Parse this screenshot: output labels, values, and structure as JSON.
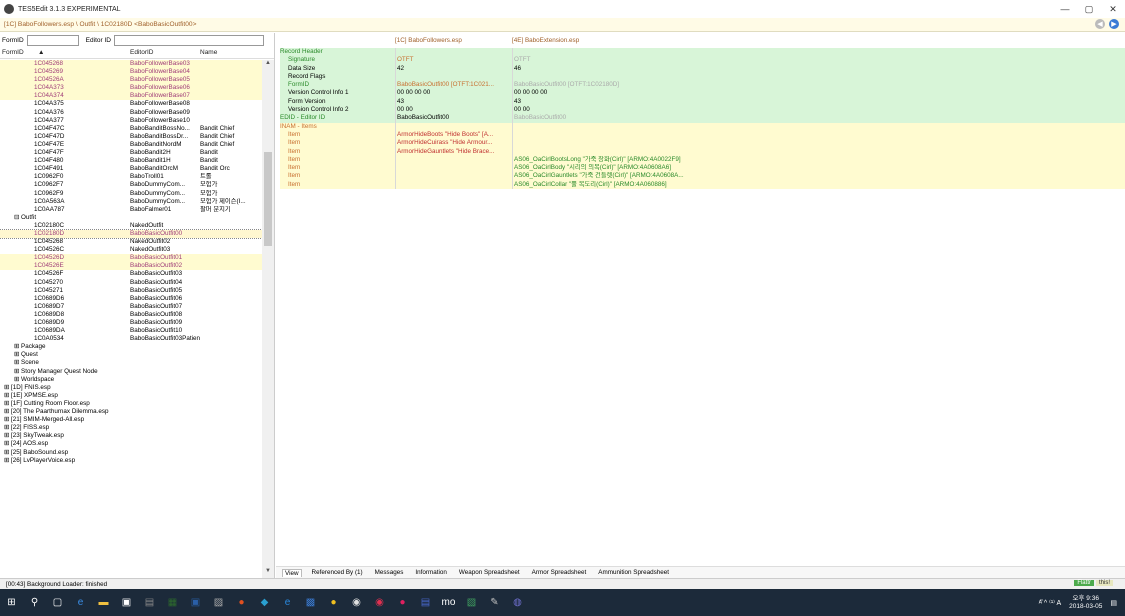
{
  "app": {
    "title": "TES5Edit 3.1.3 EXPERIMENTAL"
  },
  "path": "[1C] BaboFollowers.esp \\ Outfit \\ 1C02180D <BaboBasicOutfit00>",
  "filter": {
    "formid_label": "FormID",
    "editorid_label": "Editor ID",
    "formid_value": "",
    "editorid_value": ""
  },
  "left_columns": {
    "formid": "FormID",
    "sort_glyph": "▲",
    "editorid": "EditorID",
    "name": "Name"
  },
  "tree_rows": [
    {
      "fid": "1C045268",
      "eid": "BaboFollowerBase03",
      "name": "",
      "cls": "hl mod"
    },
    {
      "fid": "1C045269",
      "eid": "BaboFollowerBase04",
      "name": "",
      "cls": "hl mod"
    },
    {
      "fid": "1C04526A",
      "eid": "BaboFollowerBase05",
      "name": "",
      "cls": "hl mod"
    },
    {
      "fid": "1C04A373",
      "eid": "BaboFollowerBase06",
      "name": "",
      "cls": "hl mod"
    },
    {
      "fid": "1C04A374",
      "eid": "BaboFollowerBase07",
      "name": "",
      "cls": "hl mod"
    },
    {
      "fid": "1C04A375",
      "eid": "BaboFollowerBase08",
      "name": "",
      "cls": ""
    },
    {
      "fid": "1C04A376",
      "eid": "BaboFollowerBase09",
      "name": "",
      "cls": ""
    },
    {
      "fid": "1C04A377",
      "eid": "BaboFollowerBase10",
      "name": "",
      "cls": ""
    },
    {
      "fid": "1C04F47C",
      "eid": "BaboBanditBossNo...",
      "name": "Bandit Chief",
      "cls": ""
    },
    {
      "fid": "1C04F47D",
      "eid": "BaboBanditBossDr...",
      "name": "Bandit Chief",
      "cls": ""
    },
    {
      "fid": "1C04F47E",
      "eid": "BaboBanditNordM",
      "name": "Bandit Chief",
      "cls": ""
    },
    {
      "fid": "1C04F47F",
      "eid": "BaboBandit2H",
      "name": "Bandit",
      "cls": ""
    },
    {
      "fid": "1C04F480",
      "eid": "BaboBandit1H",
      "name": "Bandit",
      "cls": ""
    },
    {
      "fid": "1C04F491",
      "eid": "BaboBanditOrcM",
      "name": "Bandit Orc",
      "cls": ""
    },
    {
      "fid": "1C0962F0",
      "eid": "BaboTroll01",
      "name": "트롤",
      "cls": ""
    },
    {
      "fid": "1C0962F7",
      "eid": "BaboDummyCom...",
      "name": "모험가",
      "cls": ""
    },
    {
      "fid": "1C0962F9",
      "eid": "BaboDummyCom...",
      "name": "모험가",
      "cls": ""
    },
    {
      "fid": "1C0A563A",
      "eid": "BaboDummyCom...",
      "name": "모험가 제이슨(I...",
      "cls": ""
    },
    {
      "fid": "1C0AA787",
      "eid": "BaboFalmer01",
      "name": "팔머 분지기",
      "cls": ""
    },
    {
      "fid": "⊟  Outfit",
      "eid": "",
      "name": "",
      "cls": "grp"
    },
    {
      "fid": "1C02180C",
      "eid": "NakedOutfit",
      "name": "",
      "cls": ""
    },
    {
      "fid": "1C02180D",
      "eid": "BaboBasicOutfit00",
      "name": "",
      "cls": "sel mod"
    },
    {
      "fid": "1C045268",
      "eid": "NakedOutfit02",
      "name": "",
      "cls": ""
    },
    {
      "fid": "1C04526C",
      "eid": "NakedOutfit03",
      "name": "",
      "cls": ""
    },
    {
      "fid": "1C04526D",
      "eid": "BaboBasicOutfit01",
      "name": "",
      "cls": "hl mod"
    },
    {
      "fid": "1C04526E",
      "eid": "BaboBasicOutfit02",
      "name": "",
      "cls": "hl mod"
    },
    {
      "fid": "1C04526F",
      "eid": "BaboBasicOutfit03",
      "name": "",
      "cls": ""
    },
    {
      "fid": "1C045270",
      "eid": "BaboBasicOutfit04",
      "name": "",
      "cls": ""
    },
    {
      "fid": "1C045271",
      "eid": "BaboBasicOutfit05",
      "name": "",
      "cls": ""
    },
    {
      "fid": "1C0689D6",
      "eid": "BaboBasicOutfit06",
      "name": "",
      "cls": ""
    },
    {
      "fid": "1C0689D7",
      "eid": "BaboBasicOutfit07",
      "name": "",
      "cls": ""
    },
    {
      "fid": "1C0689D8",
      "eid": "BaboBasicOutfit08",
      "name": "",
      "cls": ""
    },
    {
      "fid": "1C0689D9",
      "eid": "BaboBasicOutfit09",
      "name": "",
      "cls": ""
    },
    {
      "fid": "1C0689DA",
      "eid": "BaboBasicOutfit10",
      "name": "",
      "cls": ""
    },
    {
      "fid": "1C0A0534",
      "eid": "BaboBasicOutfit03Patient",
      "name": "",
      "cls": ""
    },
    {
      "fid": "⊞  Package",
      "eid": "",
      "name": "",
      "cls": "grp"
    },
    {
      "fid": "⊞  Quest",
      "eid": "",
      "name": "",
      "cls": "grp"
    },
    {
      "fid": "⊞  Scene",
      "eid": "",
      "name": "",
      "cls": "grp"
    },
    {
      "fid": "⊞  Story Manager Quest Node",
      "eid": "",
      "name": "",
      "cls": "grp"
    },
    {
      "fid": "⊞  Worldspace",
      "eid": "",
      "name": "",
      "cls": "grp"
    },
    {
      "fid": "⊞  [1D] FNIS.esp",
      "eid": "",
      "name": "",
      "cls": "top"
    },
    {
      "fid": "⊞  [1E] XPMSE.esp",
      "eid": "",
      "name": "",
      "cls": "top"
    },
    {
      "fid": "⊞  [1F] Cutting Room Floor.esp",
      "eid": "",
      "name": "",
      "cls": "top"
    },
    {
      "fid": "⊞  [20] The Paarthurnax Dilemma.esp",
      "eid": "",
      "name": "",
      "cls": "top"
    },
    {
      "fid": "⊞  [21] SMIM-Merged-All.esp",
      "eid": "",
      "name": "",
      "cls": "top"
    },
    {
      "fid": "⊞  [22] FISS.esp",
      "eid": "",
      "name": "",
      "cls": "top"
    },
    {
      "fid": "⊞  [23] SkyTweak.esp",
      "eid": "",
      "name": "",
      "cls": "top"
    },
    {
      "fid": "⊞  [24] AOS.esp",
      "eid": "",
      "name": "",
      "cls": "top"
    },
    {
      "fid": "⊞  [25] BaboSound.esp",
      "eid": "",
      "name": "",
      "cls": "top"
    },
    {
      "fid": "⊞  [26] LvPlayerVoice.esp",
      "eid": "",
      "name": "",
      "cls": "top"
    }
  ],
  "right_columns": {
    "file1": "[1C] BaboFollowers.esp",
    "file2": "[4E] BaboExtension.esp"
  },
  "record_rows": [
    {
      "l": "Record Header",
      "a": "",
      "b": "",
      "bg": "g",
      "ind": false,
      "lc": "lbl-green",
      "ac": "",
      "bc": ""
    },
    {
      "l": "Signature",
      "a": "OTFT",
      "b": "OTFT",
      "bg": "g",
      "ind": true,
      "lc": "lbl-green",
      "ac": "lbl-orange",
      "bc": "lbl-gray"
    },
    {
      "l": "Data Size",
      "a": "42",
      "b": "46",
      "bg": "g",
      "ind": true,
      "lc": "",
      "ac": "",
      "bc": ""
    },
    {
      "l": "Record Flags",
      "a": "",
      "b": "",
      "bg": "g",
      "ind": true,
      "lc": "",
      "ac": "",
      "bc": ""
    },
    {
      "l": "FormID",
      "a": "BaboBasicOutfit00 [OTFT:1C021...",
      "b": "BaboBasicOutfit00 [OTFT:1C02180D]",
      "bg": "g",
      "ind": true,
      "lc": "lbl-green",
      "ac": "lbl-orange",
      "bc": "lbl-gray"
    },
    {
      "l": "Version Control Info 1",
      "a": "00 00 00 00",
      "b": "00 00 00 00",
      "bg": "g",
      "ind": true,
      "lc": "",
      "ac": "",
      "bc": ""
    },
    {
      "l": "Form Version",
      "a": "43",
      "b": "43",
      "bg": "g",
      "ind": true,
      "lc": "",
      "ac": "",
      "bc": ""
    },
    {
      "l": "Version Control Info 2",
      "a": "00 00",
      "b": "00 00",
      "bg": "g",
      "ind": true,
      "lc": "",
      "ac": "",
      "bc": ""
    },
    {
      "l": "EDID - Editor ID",
      "a": "BaboBasicOutfit00",
      "b": "BaboBasicOutfit00",
      "bg": "g",
      "ind": false,
      "lc": "lbl-green",
      "ac": "",
      "bc": "lbl-gray"
    },
    {
      "l": "INAM - Items",
      "a": "",
      "b": "",
      "bg": "y",
      "ind": false,
      "lc": "lbl-orange",
      "ac": "",
      "bc": ""
    },
    {
      "l": "Item",
      "a": "ArmorHideBoots \"Hide Boots\" [A...",
      "b": "",
      "bg": "y",
      "ind": true,
      "lc": "lbl-orange",
      "ac": "lbl-red",
      "bc": ""
    },
    {
      "l": "Item",
      "a": "ArmorHideCuirass \"Hide Armour...",
      "b": "",
      "bg": "y",
      "ind": true,
      "lc": "lbl-orange",
      "ac": "lbl-red",
      "bc": ""
    },
    {
      "l": "Item",
      "a": "ArmorHideGauntlets \"Hide Brace...",
      "b": "",
      "bg": "y",
      "ind": true,
      "lc": "lbl-orange",
      "ac": "lbl-red",
      "bc": ""
    },
    {
      "l": "Item",
      "a": "",
      "b": "AS06_OaCirlBootsLong \"가죽 장화(Cirl)\" [ARMO:4A0022F9]",
      "bg": "y",
      "ind": true,
      "lc": "lbl-orange",
      "ac": "",
      "bc": "lbl-green"
    },
    {
      "l": "Item",
      "a": "",
      "b": "AS06_OaCirlBody \"시리의 의복(Cirl)\" [ARMO:4A0608A6]",
      "bg": "y",
      "ind": true,
      "lc": "lbl-orange",
      "ac": "",
      "bc": "lbl-green"
    },
    {
      "l": "Item",
      "a": "",
      "b": "AS06_OaCirlGauntlets \"가죽 건틀렛(Cirl)\" [ARMO:4A0608A...",
      "bg": "y",
      "ind": true,
      "lc": "lbl-orange",
      "ac": "",
      "bc": "lbl-green"
    },
    {
      "l": "Item",
      "a": "",
      "b": "AS06_OaCirlCollar \"뿔 목도리(Cirl)\" [ARMO:4A060886]",
      "bg": "y",
      "ind": true,
      "lc": "lbl-orange",
      "ac": "",
      "bc": "lbl-green"
    }
  ],
  "tabs": [
    "View",
    "Referenced By (1)",
    "Messages",
    "Information",
    "Weapon Spreadsheet",
    "Armor Spreadsheet",
    "Ammunition Spreadsheet"
  ],
  "status": {
    "text": "[00:43] Background Loader: finished",
    "badge1": "Flattr",
    "badge2": "this!"
  },
  "taskbar": {
    "icons": [
      {
        "name": "start-icon",
        "glyph": "⊞",
        "color": "#ffffff"
      },
      {
        "name": "search-icon",
        "glyph": "⚲",
        "color": "#ffffff"
      },
      {
        "name": "task-view-icon",
        "glyph": "▢",
        "color": "#ffffff"
      },
      {
        "name": "edge-icon",
        "glyph": "e",
        "color": "#3a8ee6"
      },
      {
        "name": "explorer-icon",
        "glyph": "▬",
        "color": "#f0c040"
      },
      {
        "name": "store-icon",
        "glyph": "▣",
        "color": "#ffffff"
      },
      {
        "name": "app1-icon",
        "glyph": "▤",
        "color": "#888888"
      },
      {
        "name": "app2-icon",
        "glyph": "▦",
        "color": "#2d6a2d"
      },
      {
        "name": "app3-icon",
        "glyph": "▣",
        "color": "#2a5fa8"
      },
      {
        "name": "app4-icon",
        "glyph": "▨",
        "color": "#aaaaaa"
      },
      {
        "name": "app5-icon",
        "glyph": "●",
        "color": "#e05020"
      },
      {
        "name": "app6-icon",
        "glyph": "◆",
        "color": "#2aa0d0"
      },
      {
        "name": "ie-icon",
        "glyph": "e",
        "color": "#2a8ae0"
      },
      {
        "name": "app7-icon",
        "glyph": "▩",
        "color": "#3a7ad0"
      },
      {
        "name": "app8-icon",
        "glyph": "●",
        "color": "#f0c020"
      },
      {
        "name": "chrome-icon",
        "glyph": "◉",
        "color": "#e0e0e0"
      },
      {
        "name": "app9-icon",
        "glyph": "◉",
        "color": "#e03050"
      },
      {
        "name": "app10-icon",
        "glyph": "●",
        "color": "#e02060"
      },
      {
        "name": "app11-icon",
        "glyph": "▤",
        "color": "#4a6ad0"
      },
      {
        "name": "app12-icon",
        "glyph": "mo",
        "color": "#ffffff"
      },
      {
        "name": "app13-icon",
        "glyph": "▧",
        "color": "#40a060"
      },
      {
        "name": "app14-icon",
        "glyph": "✎",
        "color": "#c0c0c0"
      },
      {
        "name": "app15-icon",
        "glyph": "◍",
        "color": "#7070d0"
      }
    ],
    "tray_icons": "ᴬ̂  ^ ⁽¹⁾ A",
    "time": "오후 9:36",
    "date": "2018-03-05"
  }
}
